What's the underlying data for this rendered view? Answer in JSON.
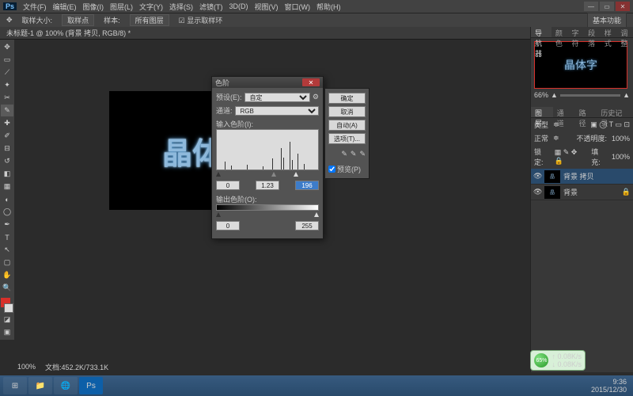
{
  "app": {
    "name": "Ps"
  },
  "menu": {
    "items": [
      "文件(F)",
      "编辑(E)",
      "图像(I)",
      "图层(L)",
      "文字(Y)",
      "选择(S)",
      "滤镜(T)",
      "3D(D)",
      "视图(V)",
      "窗口(W)",
      "帮助(H)"
    ]
  },
  "options": {
    "tool": "✥",
    "sizeLabel": "取样大小:",
    "sizeValue": "取样点",
    "sampleLabel": "样本:",
    "sampleValue": "所有图层",
    "ringLabel": "显示取样环",
    "rightPanel": "基本功能"
  },
  "doc": {
    "tab": "未标题-1 @ 100% (背景 拷贝, RGB/8) *",
    "zoom": "100%",
    "docinfo": "文档:452.2K/733.1K",
    "canvasText": "晶体字"
  },
  "navigator": {
    "tabs": [
      "导航器",
      "颜色",
      "字符",
      "段落",
      "样式",
      "调整"
    ],
    "thumbText": "晶体字",
    "zoomVal": "66%"
  },
  "layerTabs": [
    "图层",
    "通道",
    "路径",
    "历史记录"
  ],
  "layerPanel": {
    "kind": "类型",
    "blend": "正常",
    "opLabel": "不透明度:",
    "opVal": "100%",
    "lockLabel": "锁定:",
    "fillLabel": "填充:",
    "fillVal": "100%"
  },
  "layers": [
    {
      "name": "背景 拷贝",
      "thumb": "晶",
      "locked": false
    },
    {
      "name": "背景",
      "thumb": "晶",
      "locked": true
    }
  ],
  "levels": {
    "title": "色阶",
    "presetLabel": "预设(E):",
    "presetValue": "自定",
    "channelLabel": "通道:",
    "channelValue": "RGB",
    "inputLabel": "输入色阶(I):",
    "inBlack": "0",
    "inGamma": "1.23",
    "inWhite": "196",
    "outputLabel": "输出色阶(O):",
    "outBlack": "0",
    "outWhite": "255",
    "ok": "确定",
    "cancel": "取消",
    "auto": "自动(A)",
    "options": "选项(T)...",
    "preview": "预览(P)"
  },
  "taskbar": {
    "time": "9:36",
    "date": "2015/12/30"
  },
  "net": {
    "pct": "65%",
    "up": "↑ 0.08K/s",
    "down": "↓ 0.08K/s"
  }
}
